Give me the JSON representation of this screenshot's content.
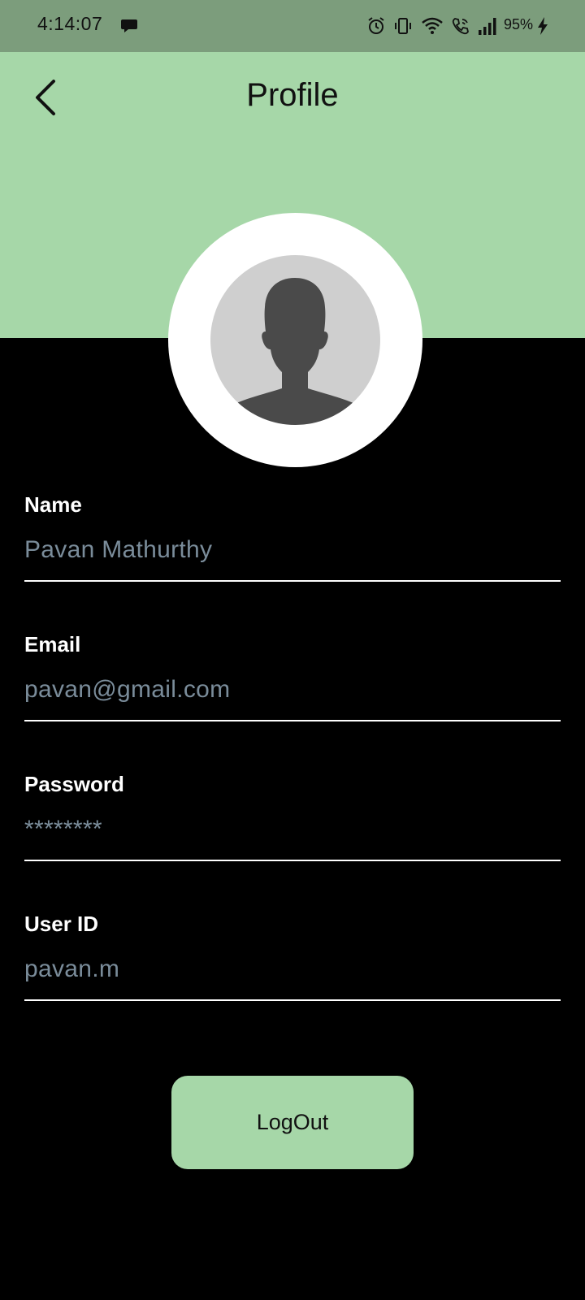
{
  "status_bar": {
    "time": "4:14:07",
    "battery_percent": "95%",
    "icons": [
      "message-icon",
      "alarm-icon",
      "vibrate-icon",
      "wifi-icon",
      "wifi-calling-icon",
      "signal-icon",
      "battery-charging-icon"
    ]
  },
  "header": {
    "title": "Profile",
    "back_icon": "chevron-left-icon"
  },
  "avatar": {
    "icon": "person-silhouette-icon"
  },
  "fields": {
    "name": {
      "label": "Name",
      "value": "Pavan Mathurthy"
    },
    "email": {
      "label": "Email",
      "value": "pavan@gmail.com"
    },
    "password": {
      "label": "Password",
      "value": "********"
    },
    "user_id": {
      "label": "User ID",
      "value": "pavan.m"
    }
  },
  "logout": {
    "label": "LogOut"
  },
  "colors": {
    "accent": "#a6d7a8",
    "status_bar": "#7c9d7c",
    "background": "#000000",
    "value_text": "#7a8c9a"
  }
}
